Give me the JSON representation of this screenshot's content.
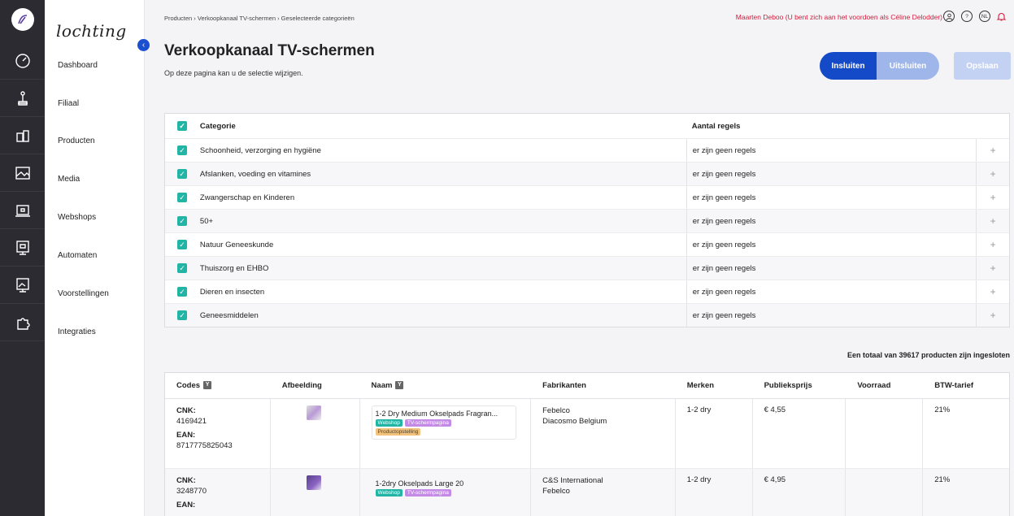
{
  "brand": "lochting",
  "nav": {
    "items": [
      "Dashboard",
      "Filiaal",
      "Producten",
      "Media",
      "Webshops",
      "Automaten",
      "Voorstellingen",
      "Integraties"
    ],
    "icons": [
      "speedometer-icon",
      "joystick-icon",
      "products-icon",
      "media-icon",
      "webshop-icon",
      "vending-machine-icon",
      "presentation-icon",
      "puzzle-icon"
    ],
    "collapse": "‹"
  },
  "breadcrumb": "Producten  ›  Verkoopkanaal TV-schermen  ›  Geselecteerde categorieën",
  "user": "Maarten Deboo (U bent zich aan het voordoen als Céline Delodder)",
  "lang": "NL",
  "help": "?",
  "title": "Verkoopkanaal TV-schermen",
  "subtitle": "Op deze pagina kan u de selectie wijzigen.",
  "buttons": {
    "include": "Insluiten",
    "exclude": "Uitsluiten",
    "save": "Opslaan"
  },
  "category_table": {
    "headers": {
      "category": "Categorie",
      "rules": "Aantal regels"
    },
    "rows": [
      {
        "name": "Schoonheid, verzorging en hygiëne",
        "rules": "er zijn geen regels"
      },
      {
        "name": "Afslanken, voeding en vitamines",
        "rules": "er zijn geen regels"
      },
      {
        "name": "Zwangerschap en Kinderen",
        "rules": "er zijn geen regels"
      },
      {
        "name": "50+",
        "rules": "er zijn geen regels"
      },
      {
        "name": "Natuur Geneeskunde",
        "rules": "er zijn geen regels"
      },
      {
        "name": "Thuiszorg en EHBO",
        "rules": "er zijn geen regels"
      },
      {
        "name": "Dieren en insecten",
        "rules": "er zijn geen regels"
      },
      {
        "name": "Geneesmiddelen",
        "rules": "er zijn geen regels"
      }
    ],
    "plus": "+"
  },
  "total": "Een totaal van 39617 producten zijn ingesloten",
  "product_table": {
    "headers": {
      "codes": "Codes",
      "image": "Afbeelding",
      "name": "Naam",
      "manufacturers": "Fabrikanten",
      "brands": "Merken",
      "price": "Publieksprijs",
      "stock": "Voorraad",
      "vat": "BTW-tarief"
    },
    "filter_icon": "Y",
    "rows": [
      {
        "cnk_label": "CNK:",
        "cnk": "4169421",
        "ean_label": "EAN:",
        "ean": "8717775825043",
        "name": "1-2 Dry Medium Okselpads Fragran...",
        "tags": [
          "Webshop",
          "TV-schermpagina",
          "Productopstelling"
        ],
        "manufacturers": [
          "Febelco",
          "Diacosmo Belgium"
        ],
        "brand": "1-2 dry",
        "price": "€ 4,55",
        "stock": "",
        "vat": "21%"
      },
      {
        "cnk_label": "CNK:",
        "cnk": "3248770",
        "ean_label": "EAN:",
        "ean": "",
        "name": "1-2dry Okselpads Large 20",
        "tags": [
          "Webshop",
          "TV-schermpagina"
        ],
        "manufacturers": [
          "C&S International",
          "Febelco"
        ],
        "brand": "1-2 dry",
        "price": "€ 4,95",
        "stock": "",
        "vat": "21%"
      }
    ]
  }
}
